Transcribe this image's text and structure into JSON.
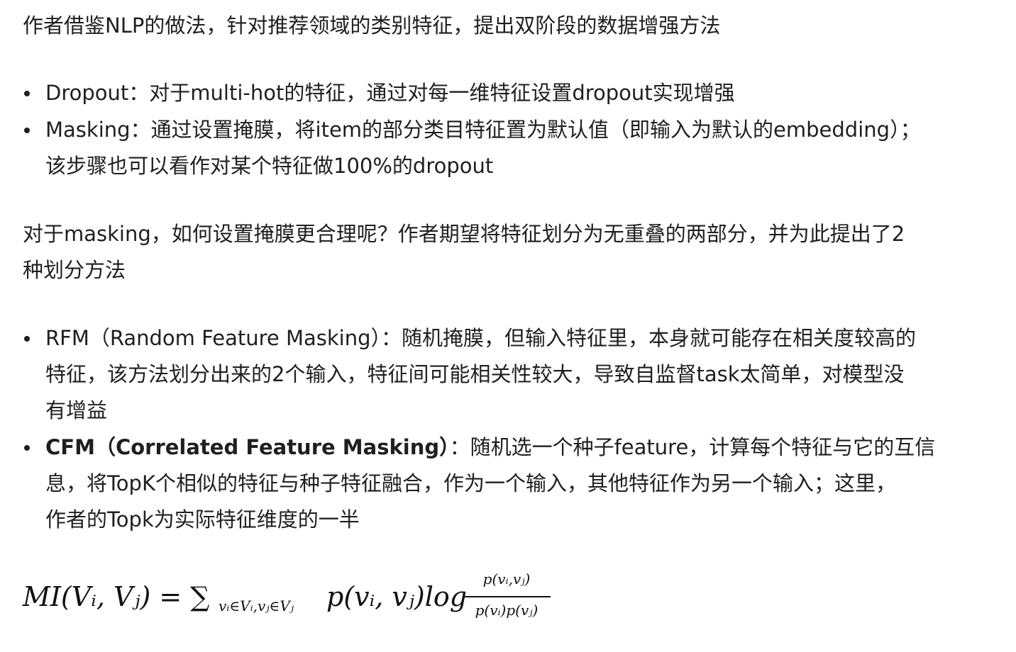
{
  "intro": "作者借鉴NLP的做法，针对推荐领域的类别特征，提出双阶段的数据增强方法",
  "augmentations": [
    {
      "line1": "Dropout：对于multi-hot的特征，通过对每一维特征设置dropout实现增强"
    },
    {
      "line1": "Masking：通过设置掩膜，将item的部分类目特征置为默认值（即输入为默认的embedding）；",
      "line2": "该步骤也可以看作对某个特征做100%的dropout"
    }
  ],
  "masking_question": {
    "line1": "对于masking，如何设置掩膜更合理呢？作者期望将特征划分为无重叠的两部分，并为此提出了2",
    "line2": "种划分方法"
  },
  "methods": [
    {
      "title": "RFM（Random Feature Masking）",
      "line1_rest": "：随机掩膜，但输入特征里，本身就可能存在相关度较高的",
      "line2": "特征，该方法划分出来的2个输入，特征间可能相关性较大，导致自监督task太简单，对模型没",
      "line3": "有增益"
    },
    {
      "title": "CFM（Correlated Feature Masking）",
      "line1_rest": "：随机选一个种子feature，计算每个特征与它的互信",
      "line2": "息，将TopK个相似的特征与种子特征融合，作为一个输入，其他特征作为另一个输入；这里，",
      "line3": "作者的Topk为实际特征维度的一半"
    }
  ],
  "formula": {
    "lhs": "MI(Vᵢ, Vⱼ) = ∑",
    "sub": "vᵢ∈Vᵢ,vⱼ∈Vⱼ",
    "term": "p(vᵢ, vⱼ)log",
    "numerator": "p(vᵢ,vⱼ)",
    "denominator": "p(vᵢ)p(vⱼ)"
  }
}
